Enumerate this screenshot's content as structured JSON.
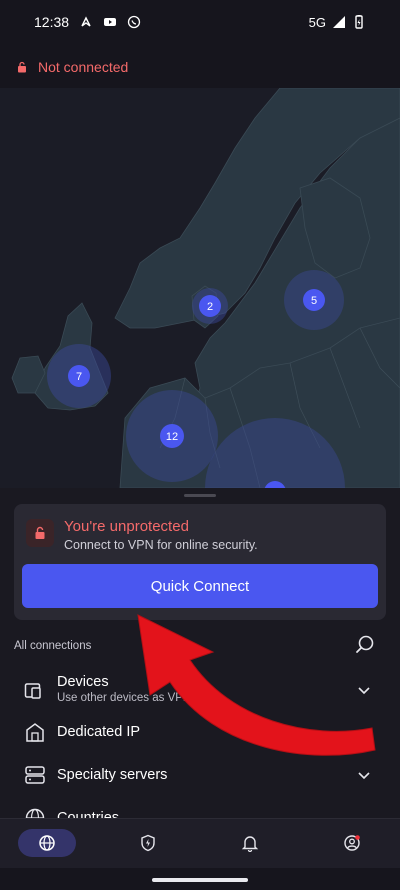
{
  "status_bar": {
    "time": "12:38",
    "network": "5G"
  },
  "connection": {
    "status": "Not connected"
  },
  "map": {
    "clusters": [
      "2",
      "5",
      "7",
      "12"
    ]
  },
  "status_card": {
    "title": "You're unprotected",
    "subtitle": "Connect to VPN for online security.",
    "quick_connect": "Quick Connect"
  },
  "list": {
    "header": "All connections",
    "items": [
      {
        "label": "Devices",
        "sub": "Use other devices as VPN s"
      },
      {
        "label": "Dedicated IP"
      },
      {
        "label": "Specialty servers"
      },
      {
        "label": "Countries"
      }
    ]
  },
  "colors": {
    "accent": "#4a57f0",
    "danger": "#f46a6a",
    "arrow": "#e3131b"
  },
  "icons": [
    "lock-icon",
    "search-icon",
    "devices-icon",
    "home-ip-icon",
    "server-icon",
    "globe-icon",
    "shield-bolt-icon",
    "bell-icon",
    "profile-icon",
    "chevron-down-icon"
  ]
}
